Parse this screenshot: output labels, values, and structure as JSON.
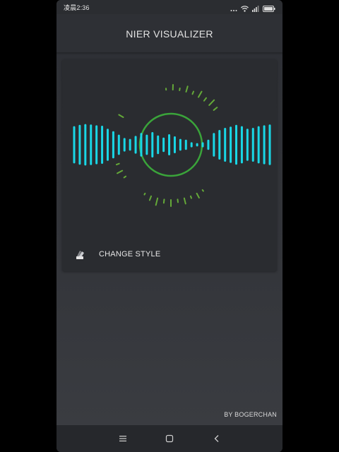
{
  "status_bar": {
    "time": "凌晨2:36",
    "icons": [
      "signal-dots-icon",
      "wifi-icon",
      "cellular-icon",
      "battery-icon"
    ]
  },
  "app_bar": {
    "title": "NIER VISUALIZER"
  },
  "visualizer": {
    "bar_color": "#19d7e6",
    "ring_color": "#3aa43a",
    "tick_color": "#6fbf3a",
    "bar_levels": [
      0.44,
      0.47,
      0.49,
      0.48,
      0.46,
      0.45,
      0.38,
      0.32,
      0.24,
      0.16,
      0.14,
      0.21,
      0.28,
      0.24,
      0.3,
      0.22,
      0.17,
      0.25,
      0.2,
      0.14,
      0.12,
      0.06,
      0.04,
      0.06,
      0.12,
      0.28,
      0.35,
      0.4,
      0.43,
      0.47,
      0.44,
      0.38,
      0.4,
      0.44,
      0.46,
      0.48
    ]
  },
  "actions": {
    "change_style_label": "CHANGE STYLE",
    "change_style_icon": "palette-icon"
  },
  "footer": {
    "credit": "BY BOGERCHAN"
  },
  "nav_bar": {
    "buttons": [
      "menu-icon",
      "home-icon",
      "back-icon"
    ]
  }
}
